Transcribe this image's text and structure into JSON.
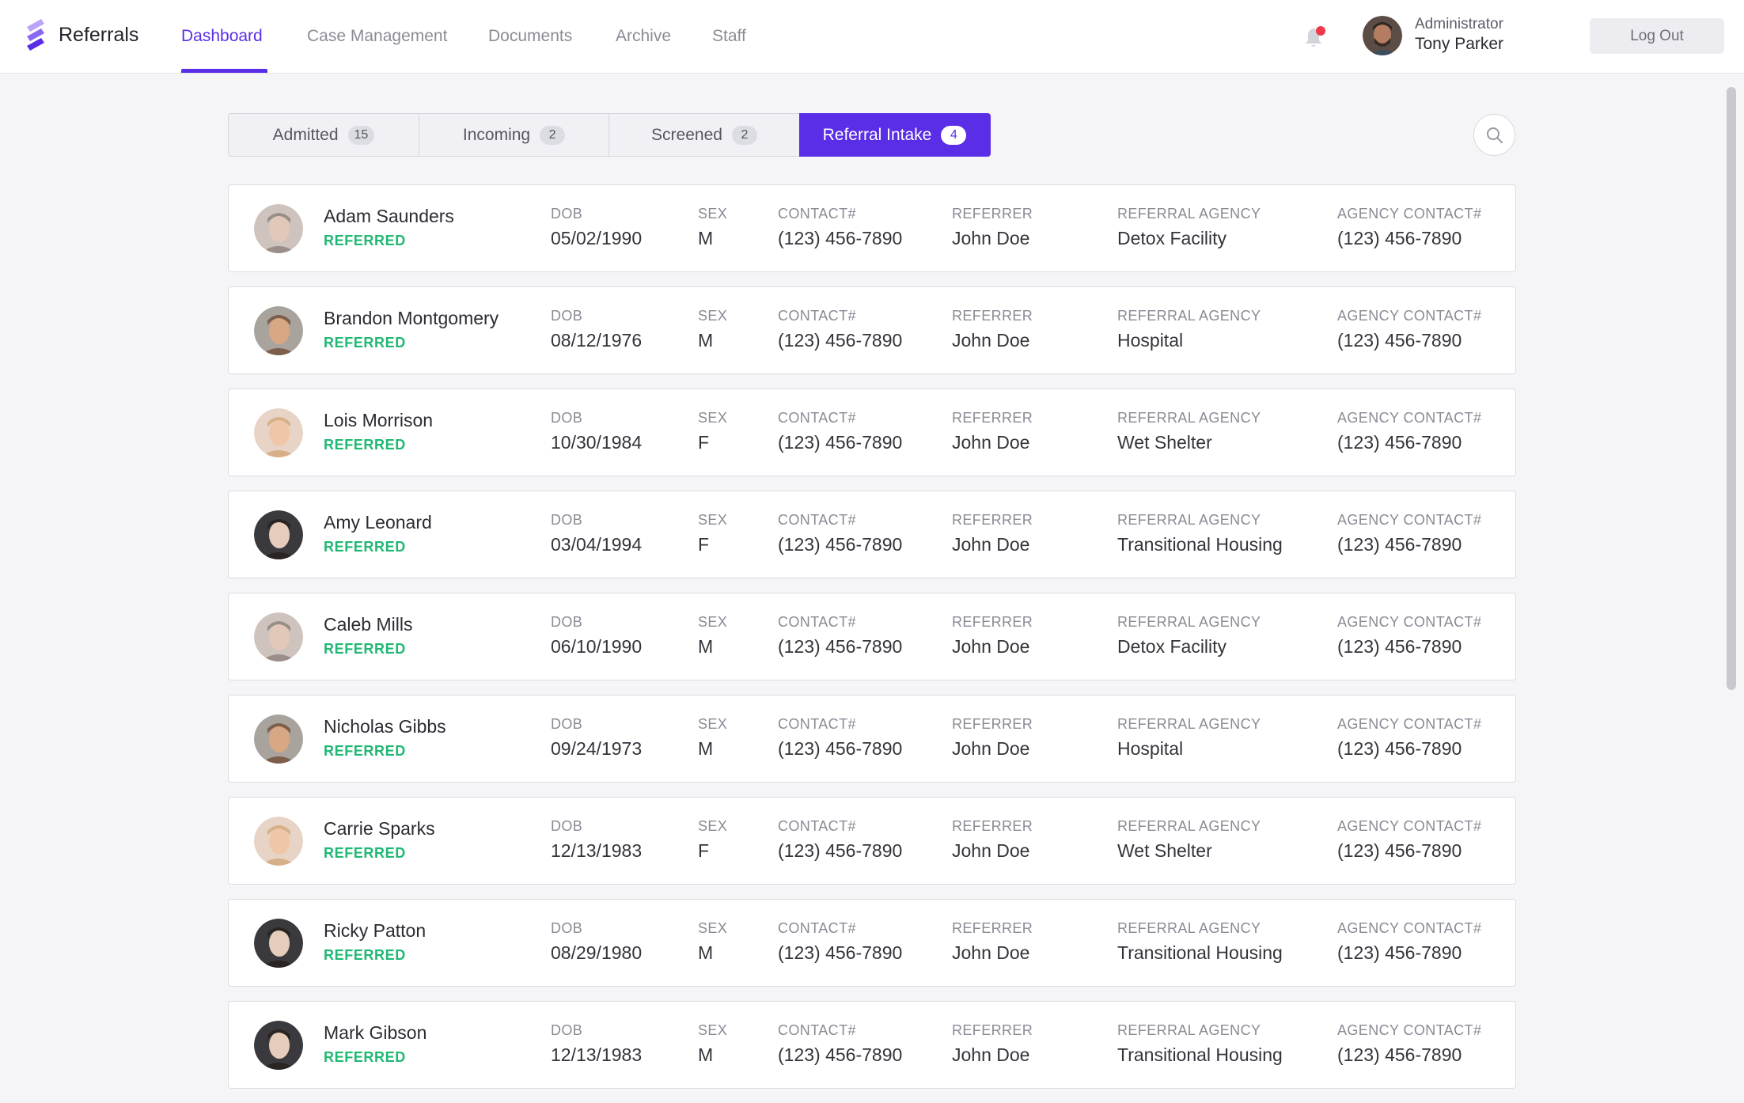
{
  "app": {
    "title": "Referrals"
  },
  "nav": [
    {
      "label": "Dashboard",
      "active": true
    },
    {
      "label": "Case Management"
    },
    {
      "label": "Documents"
    },
    {
      "label": "Archive"
    },
    {
      "label": "Staff"
    }
  ],
  "user": {
    "role": "Administrator",
    "name": "Tony Parker"
  },
  "logout_label": "Log Out",
  "tabs": [
    {
      "label": "Admitted",
      "count": "15"
    },
    {
      "label": "Incoming",
      "count": "2"
    },
    {
      "label": "Screened",
      "count": "2"
    },
    {
      "label": "Referral Intake",
      "count": "4",
      "active": true
    }
  ],
  "columns": {
    "dob": "DOB",
    "sex": "SEX",
    "contact": "CONTACT#",
    "referrer": "REFERRER",
    "agency": "REFERRAL AGENCY",
    "agency_contact": "AGENCY CONTACT#"
  },
  "referrals": [
    {
      "name": "Adam Saunders",
      "status": "REFERRED",
      "dob": "05/02/1990",
      "sex": "M",
      "contact": "(123) 456-7890",
      "referrer": "John Doe",
      "agency": "Detox Facility",
      "agency_contact": "(123) 456-7890"
    },
    {
      "name": "Brandon Montgomery",
      "status": "REFERRED",
      "dob": "08/12/1976",
      "sex": "M",
      "contact": "(123) 456-7890",
      "referrer": "John Doe",
      "agency": "Hospital",
      "agency_contact": "(123) 456-7890"
    },
    {
      "name": "Lois Morrison",
      "status": "REFERRED",
      "dob": "10/30/1984",
      "sex": "F",
      "contact": "(123) 456-7890",
      "referrer": "John Doe",
      "agency": "Wet Shelter",
      "agency_contact": "(123) 456-7890"
    },
    {
      "name": "Amy Leonard",
      "status": "REFERRED",
      "dob": "03/04/1994",
      "sex": "F",
      "contact": "(123) 456-7890",
      "referrer": "John Doe",
      "agency": "Transitional Housing",
      "agency_contact": "(123) 456-7890"
    },
    {
      "name": "Caleb Mills",
      "status": "REFERRED",
      "dob": "06/10/1990",
      "sex": "M",
      "contact": "(123) 456-7890",
      "referrer": "John Doe",
      "agency": "Detox Facility",
      "agency_contact": "(123) 456-7890"
    },
    {
      "name": "Nicholas Gibbs",
      "status": "REFERRED",
      "dob": "09/24/1973",
      "sex": "M",
      "contact": "(123) 456-7890",
      "referrer": "John Doe",
      "agency": "Hospital",
      "agency_contact": "(123) 456-7890"
    },
    {
      "name": "Carrie Sparks",
      "status": "REFERRED",
      "dob": "12/13/1983",
      "sex": "F",
      "contact": "(123) 456-7890",
      "referrer": "John Doe",
      "agency": "Wet Shelter",
      "agency_contact": "(123) 456-7890"
    },
    {
      "name": "Ricky Patton",
      "status": "REFERRED",
      "dob": "08/29/1980",
      "sex": "M",
      "contact": "(123) 456-7890",
      "referrer": "John Doe",
      "agency": "Transitional Housing",
      "agency_contact": "(123) 456-7890"
    },
    {
      "name": "Mark Gibson",
      "status": "REFERRED",
      "dob": "12/13/1983",
      "sex": "M",
      "contact": "(123) 456-7890",
      "referrer": "John Doe",
      "agency": "Transitional Housing",
      "agency_contact": "(123) 456-7890"
    }
  ],
  "icons": {
    "logo": "stacked-chevron-logo-icon",
    "notifications": "bell-icon",
    "search": "search-icon"
  },
  "colors": {
    "accent": "#5a2ee6",
    "status_referred": "#20b873",
    "notification_dot": "#ee3a4a"
  }
}
